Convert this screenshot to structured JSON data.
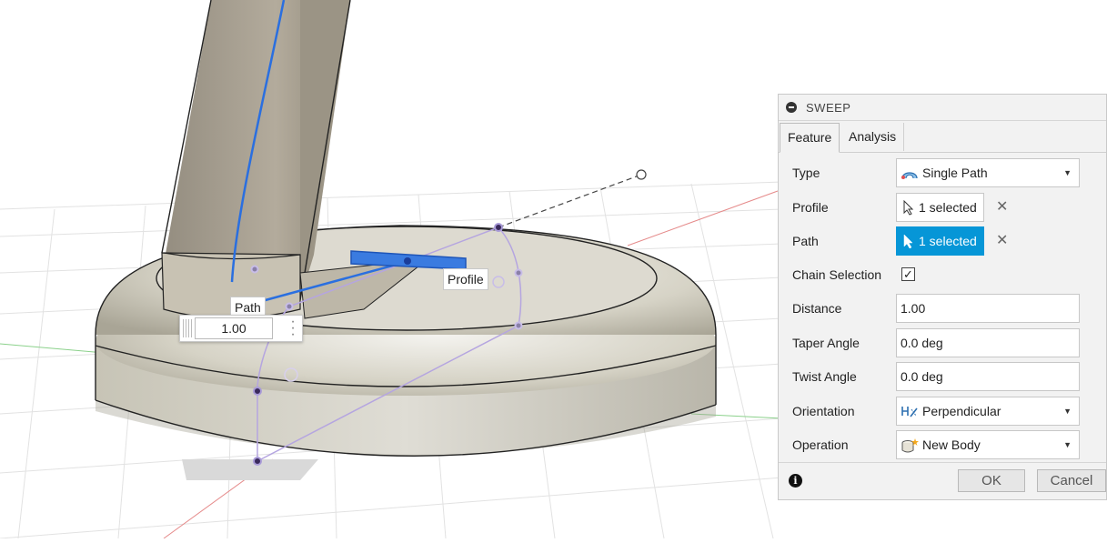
{
  "viewport": {
    "labels": {
      "path": "Path",
      "profile": "Profile"
    },
    "distance_manipulator": {
      "value": "1.00"
    }
  },
  "sweep": {
    "title": "SWEEP",
    "tabs": [
      {
        "label": "Feature",
        "active": true
      },
      {
        "label": "Analysis",
        "active": false
      }
    ],
    "type": {
      "label": "Type",
      "value": "Single Path",
      "icon": "single-path-icon"
    },
    "profile": {
      "label": "Profile",
      "value": "1 selected"
    },
    "path": {
      "label": "Path",
      "value": "1 selected",
      "active": true
    },
    "chain_selection": {
      "label": "Chain Selection",
      "checked": true,
      "mark": "✓"
    },
    "distance": {
      "label": "Distance",
      "value": "1.00"
    },
    "taper_angle": {
      "label": "Taper Angle",
      "value": "0.0 deg"
    },
    "twist_angle": {
      "label": "Twist Angle",
      "value": "0.0 deg"
    },
    "orientation": {
      "label": "Orientation",
      "value": "Perpendicular",
      "icon": "perpendicular-icon"
    },
    "operation": {
      "label": "Operation",
      "value": "New Body",
      "icon": "new-body-icon"
    },
    "ok_label": "OK",
    "cancel_label": "Cancel",
    "accent_color": "#0696d7"
  }
}
